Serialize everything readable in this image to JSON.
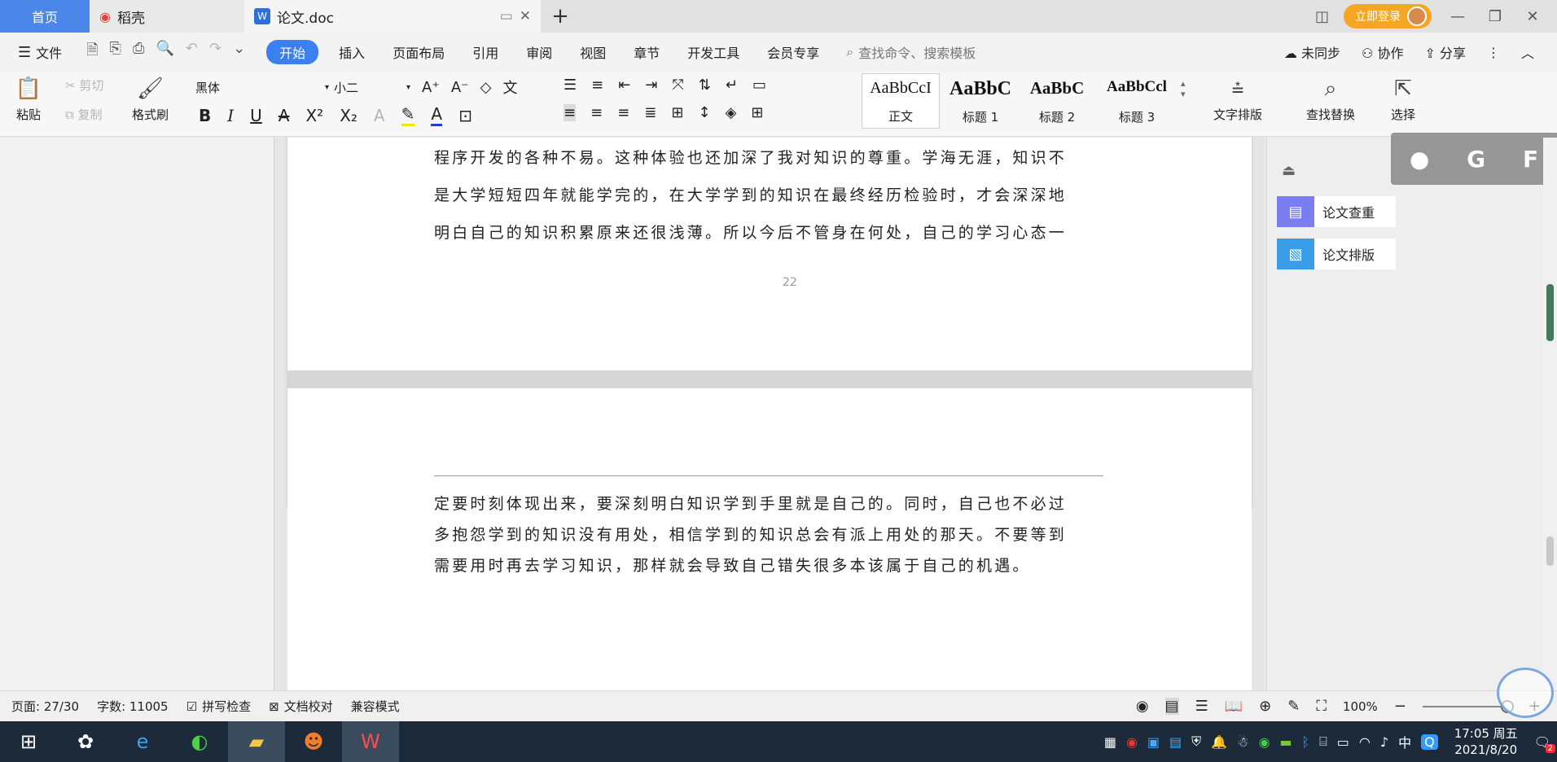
{
  "titlebar": {
    "tab_home": "首页",
    "tab_daoke": "稻壳",
    "tab_doc": "论文.doc",
    "vip_label": "立即登录",
    "win_min": "—",
    "win_restore": "❐",
    "win_close": "✕"
  },
  "menu": {
    "file": "文件",
    "items": [
      "开始",
      "插入",
      "页面布局",
      "引用",
      "审阅",
      "视图",
      "章节",
      "开发工具",
      "会员专享"
    ],
    "search_placeholder": "查找命令、搜索模板",
    "unsynced": "未同步",
    "collab": "协作",
    "share": "分享"
  },
  "ribbon": {
    "paste": "粘贴",
    "cut": "剪切",
    "copy": "复制",
    "format_painter": "格式刷",
    "font_name": "黑体",
    "font_size": "小二",
    "styles": [
      {
        "sample": "AaBbCcI",
        "name": "正文"
      },
      {
        "sample": "AaBbC",
        "name": "标题 1"
      },
      {
        "sample": "AaBbC",
        "name": "标题 2"
      },
      {
        "sample": "AaBbCcl",
        "name": "标题 3"
      }
    ],
    "text_layout": "文字排版",
    "find_replace": "查找替换",
    "select": "选择"
  },
  "document": {
    "page1_lines": [
      "程序开发的各种不易。这种体验也还加深了我对知识的尊重。学海无涯，知识不",
      "是大学短短四年就能学完的，在大学学到的知识在最终经历检验时，才会深深地",
      "明白自己的知识积累原来还很浅薄。所以今后不管身在何处，自己的学习心态一"
    ],
    "page1_number": "22",
    "page2_lines": [
      "定要时刻体现出来，要深刻明白知识学到手里就是自己的。同时，自己也不必过",
      "多抱怨学到的知识没有用处，相信学到的知识总会有派上用处的那天。不要等到",
      "需要用时再去学习知识，那样就会导致自己错失很多本该属于自己的机遇。"
    ]
  },
  "sidepanel": {
    "check": "论文查重",
    "layout": "论文排版"
  },
  "floatbar": {
    "g": "G",
    "f": "F"
  },
  "status": {
    "page": "页面: 27/30",
    "words": "字数: 11005",
    "spell": "拼写检查",
    "proof": "文档校对",
    "compat": "兼容模式",
    "zoom": "100%"
  },
  "taskbar": {
    "ime": "中",
    "time": "17:05 周五",
    "date": "2021/8/20",
    "notif_count": "2"
  },
  "colors": {
    "accent": "#3c7ff0",
    "home_tab": "#4a87e8",
    "vip": "#f5a623",
    "taskbar": "#1c2a3a"
  }
}
